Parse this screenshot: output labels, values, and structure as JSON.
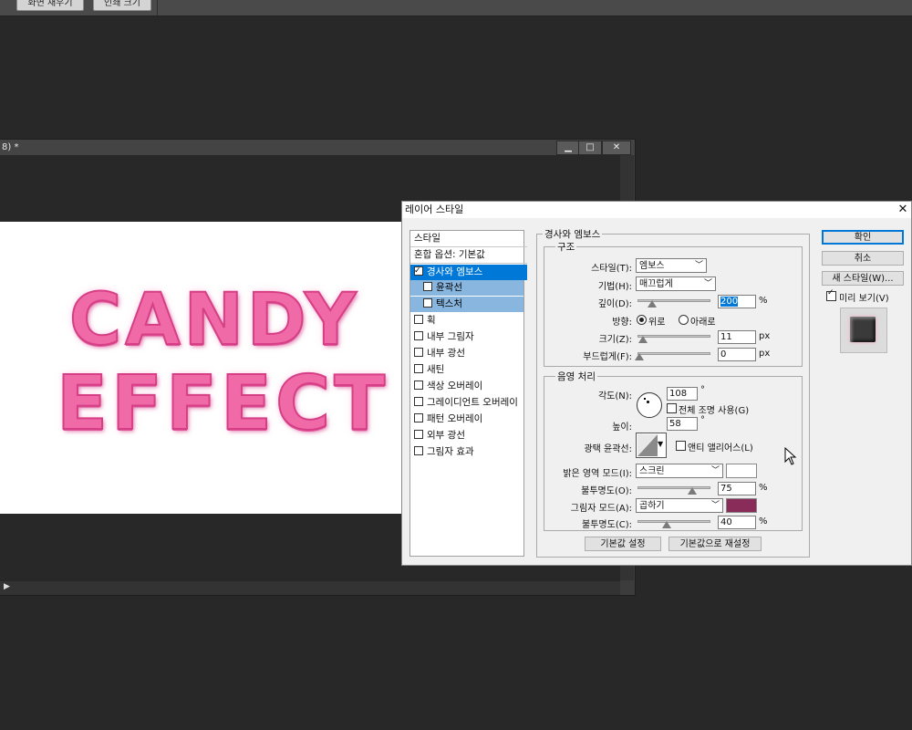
{
  "topbar": {
    "fill_screen": "화면 채우기",
    "print_size": "인쇄 크기"
  },
  "document": {
    "title": "8) *",
    "minimize": "▁",
    "restore": "□",
    "close": "✕",
    "canvas_text": [
      "CANDY",
      "EFFECT"
    ],
    "text_color": "#f06aa8"
  },
  "dialog": {
    "title": "레이어 스타일",
    "close": "✕",
    "styles_list": [
      {
        "label": "스타일",
        "checkbox": false,
        "checked": false,
        "state": "header"
      },
      {
        "label": "혼합 옵션: 기본값",
        "checkbox": false,
        "checked": false,
        "state": "header"
      },
      {
        "label": "경사와 엠보스",
        "checkbox": true,
        "checked": true,
        "state": "selected"
      },
      {
        "label": "윤곽선",
        "checkbox": true,
        "checked": false,
        "state": "sub"
      },
      {
        "label": "텍스처",
        "checkbox": true,
        "checked": false,
        "state": "sub"
      },
      {
        "label": "획",
        "checkbox": true,
        "checked": false,
        "state": "normal"
      },
      {
        "label": "내부 그림자",
        "checkbox": true,
        "checked": false,
        "state": "normal"
      },
      {
        "label": "내부 광선",
        "checkbox": true,
        "checked": false,
        "state": "normal"
      },
      {
        "label": "새틴",
        "checkbox": true,
        "checked": false,
        "state": "normal"
      },
      {
        "label": "색상 오버레이",
        "checkbox": true,
        "checked": false,
        "state": "normal"
      },
      {
        "label": "그레이디언트 오버레이",
        "checkbox": true,
        "checked": false,
        "state": "normal"
      },
      {
        "label": "패턴 오버레이",
        "checkbox": true,
        "checked": false,
        "state": "normal"
      },
      {
        "label": "외부 광선",
        "checkbox": true,
        "checked": false,
        "state": "normal"
      },
      {
        "label": "그림자 효과",
        "checkbox": true,
        "checked": false,
        "state": "normal"
      }
    ],
    "section_title": "경사와 엠보스",
    "structure": {
      "title": "구조",
      "style_label": "스타일(T):",
      "style_value": "엠보스",
      "technique_label": "기법(H):",
      "technique_value": "매끄럽게",
      "depth_label": "깊이(D):",
      "depth_value": "200",
      "depth_unit": "%",
      "direction_label": "방향:",
      "direction_up": "위로",
      "direction_down": "아래로",
      "size_label": "크기(Z):",
      "size_value": "11",
      "size_unit": "px",
      "soften_label": "부드럽게(F):",
      "soften_value": "0",
      "soften_unit": "px"
    },
    "shading": {
      "title": "음영 처리",
      "angle_label": "각도(N):",
      "angle_value": "108",
      "angle_unit": "°",
      "global_light_label": "전체 조명 사용(G)",
      "altitude_label": "높이:",
      "altitude_value": "58",
      "altitude_unit": "°",
      "gloss_contour_label": "광택 윤곽선:",
      "anti_aliased_label": "앤티 앨리어스(L)",
      "highlight_mode_label": "밝은 영역 모드(I):",
      "highlight_mode_value": "스크린",
      "highlight_opacity_label": "불투명도(O):",
      "highlight_opacity_value": "75",
      "highlight_opacity_unit": "%",
      "shadow_mode_label": "그림자 모드(A):",
      "shadow_mode_value": "곱하기",
      "shadow_opacity_label": "불투명도(C):",
      "shadow_opacity_value": "40",
      "shadow_opacity_unit": "%",
      "highlight_color": "#ffffff",
      "shadow_color": "#8a2c5a"
    },
    "make_default": "기본값 설정",
    "reset_default": "기본값으로 재설정",
    "ok": "확인",
    "cancel": "취소",
    "new_style": "새 스타일(W)...",
    "preview_label": "미리 보기(V)"
  }
}
